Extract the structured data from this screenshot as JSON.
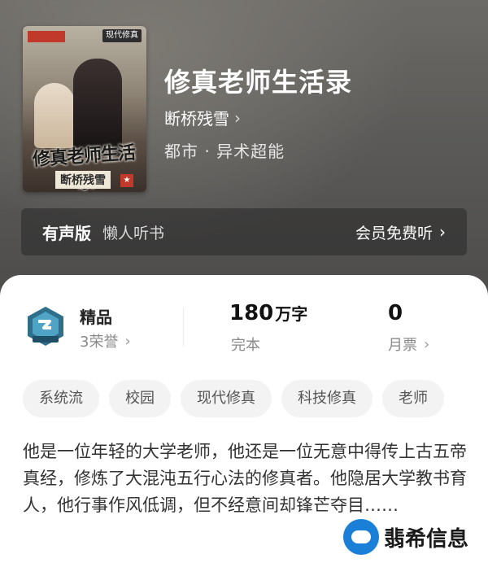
{
  "book": {
    "title": "修真老师生活录",
    "author": "断桥残雪",
    "genre": "都市 · 异术超能",
    "cover": {
      "tag_right": "现代修真",
      "title_art": "修真老师生活录",
      "author_art": "断桥残雪"
    }
  },
  "audio": {
    "label": "有声版",
    "source": "懒人听书",
    "free_label": "会员免费听"
  },
  "stats": {
    "honor_name": "精品",
    "honor_count": "3荣誉",
    "word_count_num": "180",
    "word_count_unit": "万字",
    "status": "完本",
    "votes_num": "0",
    "votes_label": "月票"
  },
  "tags": [
    "系统流",
    "校园",
    "现代修真",
    "科技修真",
    "老师"
  ],
  "description": "他是一位年轻的大学老师，他还是一位无意中得传上古五帝真经，修炼了大混沌五行心法的修真者。他隐居大学教书育人，他行事作风低调，但不经意间却锋芒夺目……",
  "watermark": {
    "text": "翡希信息"
  },
  "icons": {
    "author_chevron": "chevron-right-icon",
    "audio_chevron": "chevron-right-icon",
    "honor_chevron": "chevron-right-icon",
    "votes_chevron": "chevron-right-icon",
    "badge": "honor-badge-icon"
  },
  "colors": {
    "hero_bg": "#5b5a58",
    "card_bg": "#ffffff",
    "tag_bg": "#f3f3f3",
    "watermark_blue": "#1a7fd6"
  }
}
